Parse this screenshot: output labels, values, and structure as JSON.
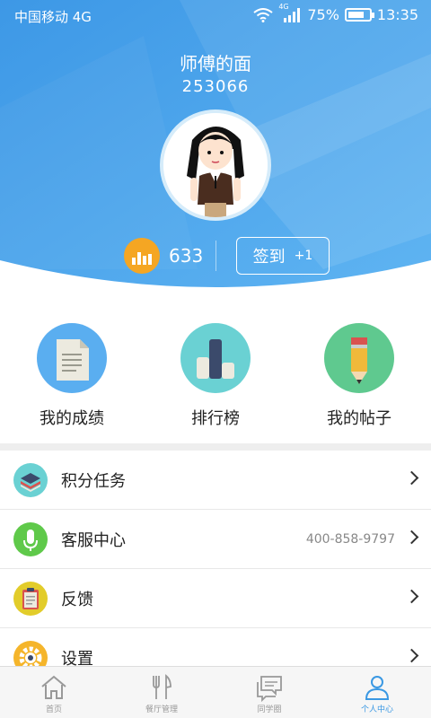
{
  "status_bar": {
    "carrier": "中国移动 4G",
    "network": "4G",
    "battery": "75%",
    "battery_level": 0.75,
    "time": "13:35"
  },
  "profile": {
    "name": "师傅的面",
    "id": "253066",
    "points": "633",
    "checkin_label": "签到",
    "checkin_bonus": "+1"
  },
  "quick_actions": [
    {
      "label": "我的成绩",
      "icon": "document-icon"
    },
    {
      "label": "排行榜",
      "icon": "ranking-bars-icon"
    },
    {
      "label": "我的帖子",
      "icon": "pencil-icon"
    }
  ],
  "menu": [
    {
      "label": "积分任务",
      "icon": "stack-layers-icon",
      "value": ""
    },
    {
      "label": "客服中心",
      "icon": "microphone-icon",
      "value": "400-858-9797"
    },
    {
      "label": "反馈",
      "icon": "clipboard-icon",
      "value": ""
    },
    {
      "label": "设置",
      "icon": "gear-icon",
      "value": ""
    }
  ],
  "tabs": [
    {
      "label": "首页",
      "icon": "home-icon",
      "active": false
    },
    {
      "label": "餐厅管理",
      "icon": "fork-knife-icon",
      "active": false
    },
    {
      "label": "同学圈",
      "icon": "chat-bubbles-icon",
      "active": false
    },
    {
      "label": "个人中心",
      "icon": "person-icon",
      "active": true
    }
  ],
  "colors": {
    "header_blue": "#4aa3ec",
    "accent": "#3a98e3",
    "coin": "#f5a623"
  }
}
